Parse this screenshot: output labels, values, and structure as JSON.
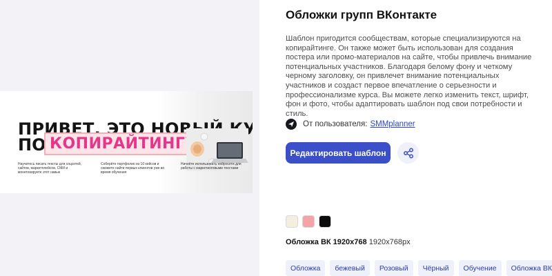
{
  "banner": {
    "headline_line1": "ПРИВЕТ, ЭТО НОВЫЙ КУРС",
    "headline_line2_prefix": "ПО",
    "headline_accent": "КОПИРАЙТИНГУ",
    "columns": [
      "Научитесь писать тексты для соцсетей, сайтов, маркетплейсов, СМИ и монетизируете этот навык",
      "Соберёте портфолио из 10 кейсов и сможете найти первых клиентов уже во время обучения",
      "Начнёте использовать нейросети для работы с маркетинговыми текстами"
    ]
  },
  "info": {
    "title": "Обложки групп ВКонтакте",
    "description": "Шаблон пригодится сообществам, которые специализируются на копирайтинге. Он также может быть использован для создания постера или промо-материалов на сайте, чтобы привлечь внимание потенциальных участников. Благодаря белому фону и четкому черному заголовку, он привлечет внимание потенциальных участников и создаст первое впечатление о серьезности и профессионализме курса. Вы можете легко изменить текст, шрифт, фон и фото, чтобы адаптировать шаблон под свои потребности и стиль.",
    "author_prefix": "От пользователя:",
    "author_name": "SMMplanner",
    "edit_button": "Редактировать шаблон",
    "share_icon": "share-icon"
  },
  "colors": [
    {
      "name": "бежевый",
      "hex": "#f2efdc"
    },
    {
      "name": "розовый",
      "hex": "#f4a3a6"
    },
    {
      "name": "чёрный",
      "hex": "#0c0c0c"
    }
  ],
  "format": {
    "name": "Обложка ВК 1920x768",
    "size": "1920x768px"
  },
  "tags": [
    "Обложка",
    "бежевый",
    "Розовый",
    "Чёрный",
    "Обучение",
    "Обложка ВК"
  ]
}
